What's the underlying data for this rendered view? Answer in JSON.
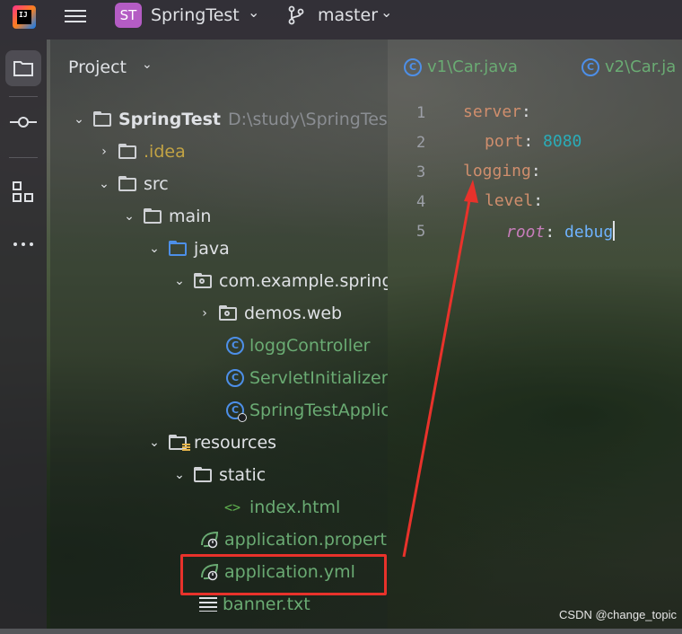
{
  "titlebar": {
    "project_badge": "ST",
    "project_name": "SpringTest",
    "branch": "master"
  },
  "panel": {
    "title": "Project"
  },
  "tree": {
    "root": "SpringTest",
    "root_path": "D:\\study\\SpringTes",
    "idea": ".idea",
    "src": "src",
    "main": "main",
    "java": "java",
    "package": "com.example.spring",
    "demos": "demos.web",
    "logg": "loggController",
    "servlet": "ServletInitializer",
    "app": "SpringTestApplic",
    "resources": "resources",
    "static": "static",
    "index": "index.html",
    "props": "application.properti",
    "yml": "application.yml",
    "banner": "banner.txt"
  },
  "editor": {
    "tabs": [
      "v1\\Car.java",
      "v2\\Car.ja"
    ],
    "line_numbers": [
      "1",
      "2",
      "3",
      "4",
      "5"
    ],
    "lines": {
      "l1_key": "server",
      "l1_colon": ":",
      "l2_key": "port",
      "l2_colon": ": ",
      "l2_val": "8080",
      "l3_key": "logging",
      "l3_colon": ":",
      "l4_key": "level",
      "l4_colon": ":",
      "l5_key": "root",
      "l5_colon": ": ",
      "l5_val": "debug"
    }
  },
  "watermark": "CSDN @change_topic",
  "colors": {
    "annotation_red": "#e8322b",
    "accent_blue": "#4d8fe8",
    "branch_icon": "git-branch-icon"
  }
}
